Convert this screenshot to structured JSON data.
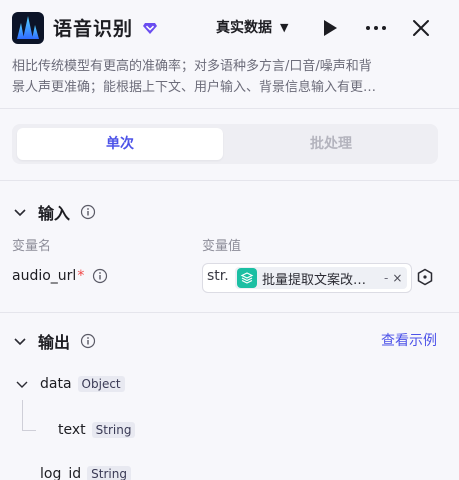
{
  "header": {
    "title": "语音识别",
    "dataset_label": "真实数据",
    "icons": {
      "logo": "speech-wave-logo",
      "premium": "diamond-icon",
      "run": "play-icon",
      "more": "more-icon",
      "close": "close-icon"
    }
  },
  "description": {
    "line1": "相比传统模型有更高的准确率；对多语种多方言/口音/噪声和背",
    "line2": "景人声更准确；能根据上下文、用户输入、背景信息输入有更…"
  },
  "mode_tabs": [
    {
      "label": "单次",
      "active": true
    },
    {
      "label": "批处理",
      "active": false
    }
  ],
  "input": {
    "title": "输入",
    "col_name": "变量名",
    "col_value": "变量值",
    "params": [
      {
        "name": "audio_url",
        "required_mark": "*",
        "type_tag": "str.",
        "ref_text": "批量提取文案改…",
        "ref_suffix": "-",
        "ref_close": "×"
      }
    ]
  },
  "output": {
    "title": "输出",
    "example_link": "查看示例",
    "fields": [
      {
        "name": "data",
        "type": "Object"
      },
      {
        "name": "text",
        "type": "String"
      },
      {
        "name": "log_id",
        "type": "String"
      }
    ]
  },
  "colors": {
    "accent": "#4d53e8",
    "premium": "#6a4df0",
    "required": "#f04646",
    "ref_icon": "#1bbfa3"
  }
}
